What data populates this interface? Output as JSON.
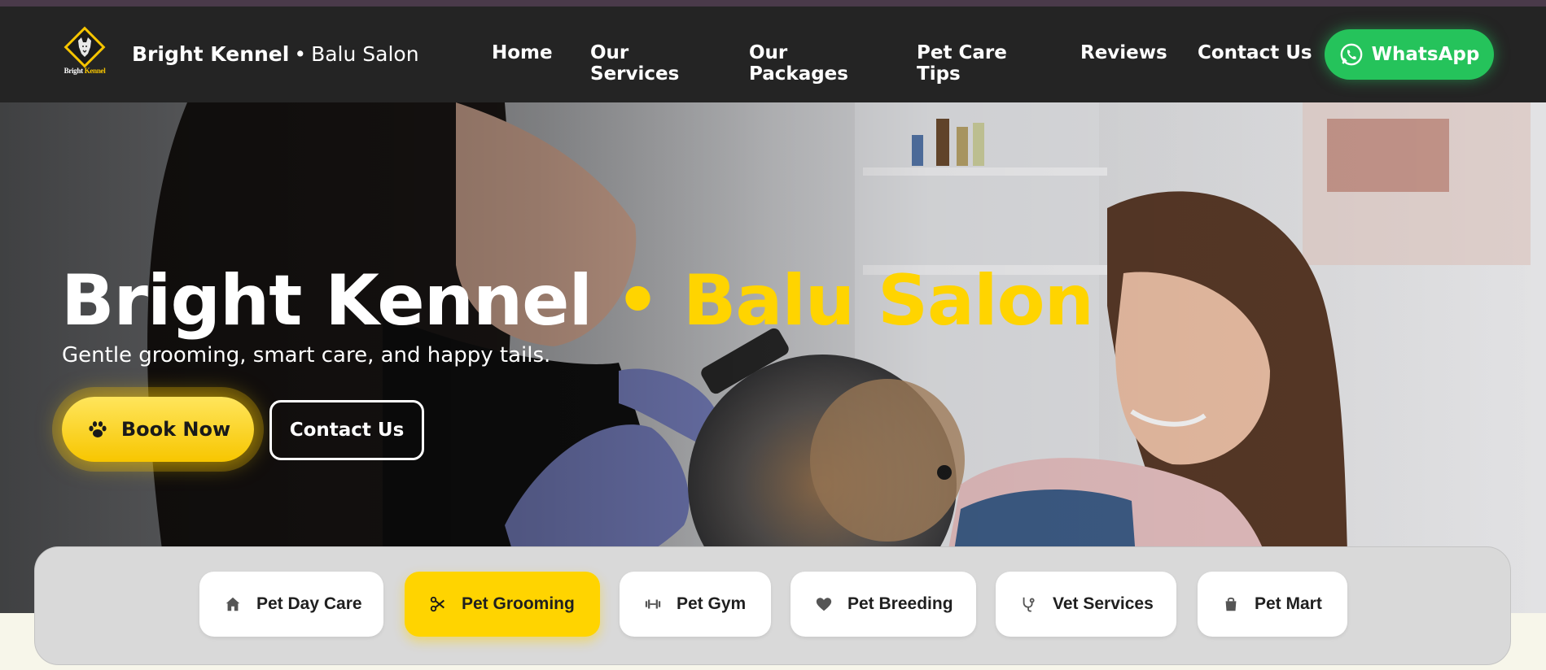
{
  "brand": {
    "logo_text_white": "Bright",
    "logo_text_yellow": "Kennel",
    "name_bold": "Bright Kennel",
    "separator": "•",
    "name_regular": "Balu Salon"
  },
  "nav": {
    "items": [
      {
        "label": "Home",
        "icon": "none"
      },
      {
        "label": "Our Services",
        "icon": "none"
      },
      {
        "label": "Our Packages",
        "icon": "none"
      },
      {
        "label": "Pet Care Tips",
        "icon": "none"
      },
      {
        "label": "Reviews",
        "icon": "none"
      },
      {
        "label": "Contact Us",
        "icon": "none"
      }
    ],
    "whatsapp_label": "WhatsApp",
    "whatsapp_icon": "whatsapp-icon"
  },
  "hero": {
    "title_white": "Bright Kennel",
    "title_dot": "•",
    "title_yellow": "Balu Salon",
    "subtitle": "Gentle grooming, smart care, and happy tails.",
    "book_label": "Book Now",
    "book_icon": "paw-icon",
    "contact_label": "Contact Us"
  },
  "services": [
    {
      "label": "Pet Day Care",
      "icon": "home-icon",
      "active": false
    },
    {
      "label": "Pet Grooming",
      "icon": "scissors-icon",
      "active": true
    },
    {
      "label": "Pet Gym",
      "icon": "dumbbell-icon",
      "active": false
    },
    {
      "label": "Pet Breeding",
      "icon": "heart-icon",
      "active": false
    },
    {
      "label": "Vet Services",
      "icon": "stethoscope-icon",
      "active": false
    },
    {
      "label": "Pet Mart",
      "icon": "shopping-bag-icon",
      "active": false
    }
  ],
  "colors": {
    "accent_yellow": "#ffd400",
    "navbar_bg": "#242424",
    "whatsapp_green": "#25c35b"
  }
}
